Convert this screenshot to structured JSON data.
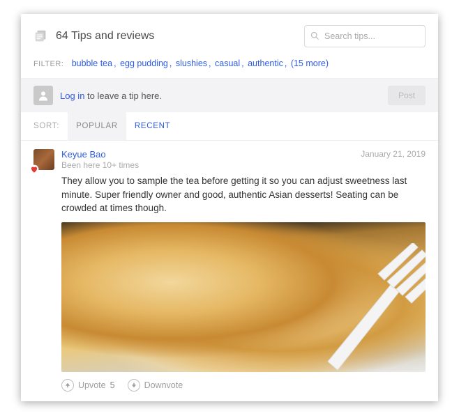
{
  "header": {
    "title": "64 Tips and reviews",
    "search_placeholder": "Search tips..."
  },
  "filters": {
    "label": "FILTER:",
    "items": [
      "bubble tea",
      "egg pudding",
      "slushies",
      "casual",
      "authentic"
    ],
    "more_label": "(15 more)"
  },
  "login_bar": {
    "login_link": "Log in",
    "suffix": " to leave a tip here.",
    "post_label": "Post"
  },
  "sort": {
    "label": "SORT:",
    "tabs": [
      {
        "label": "POPULAR",
        "active": true
      },
      {
        "label": "RECENT",
        "active": false
      }
    ]
  },
  "tips": [
    {
      "user": "Keyue Bao",
      "subtitle": "Been here 10+ times",
      "date": "January 21, 2019",
      "body": "They allow you to sample the tea before getting it so you can adjust sweetness last minute. Super friendly owner and good, authentic Asian desserts! Seating can be crowded at times though.",
      "upvote_label": "Upvote",
      "upvote_count": "5",
      "downvote_label": "Downvote"
    }
  ]
}
